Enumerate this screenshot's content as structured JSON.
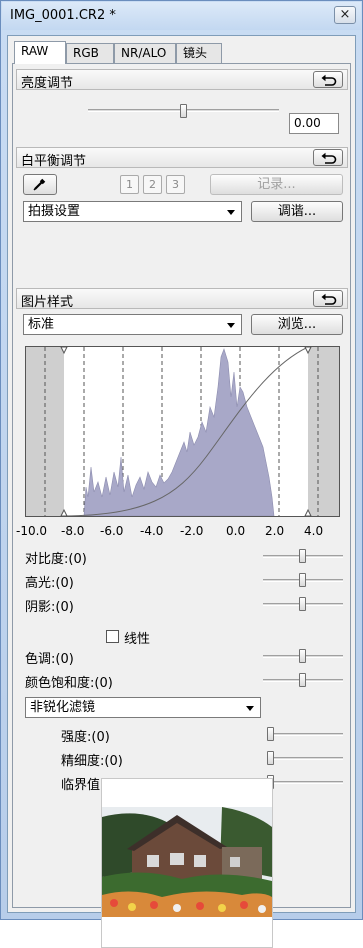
{
  "window": {
    "title": "IMG_0001.CR2 *",
    "close_glyph": "×"
  },
  "tabs": [
    {
      "label": "RAW",
      "active": true
    },
    {
      "label": "RGB",
      "active": false
    },
    {
      "label": "NR/ALO",
      "active": false
    },
    {
      "label": "镜头",
      "active": false
    }
  ],
  "brightness": {
    "title": "亮度调节",
    "value": "0.00",
    "slider_level": 0.5
  },
  "white_balance": {
    "title": "白平衡调节",
    "presets": [
      "1",
      "2",
      "3"
    ],
    "register_label": "记录...",
    "mode": "拍摄设置",
    "tune_label": "调谐..."
  },
  "picture_style": {
    "title": "图片样式",
    "style": "标准",
    "browse_label": "浏览...",
    "histogram_ticks": [
      "-10.0",
      "-8.0",
      "-6.0",
      "-4.0",
      "-2.0",
      "0.0",
      "2.0",
      "4.0"
    ],
    "params": [
      {
        "label": "对比度:(0)",
        "level": 0.5
      },
      {
        "label": "高光:(0)",
        "level": 0.5
      },
      {
        "label": "阴影:(0)",
        "level": 0.5
      },
      {
        "label": "色调:(0)",
        "level": 0.5
      },
      {
        "label": "颜色饱和度:(0)",
        "level": 0.5
      }
    ],
    "linear_label": "线性",
    "linear_checked": false,
    "sharpen_mode": "非锐化滤镜",
    "sharpen_params": [
      {
        "label": "强度:(0)",
        "level": 0
      },
      {
        "label": "精细度:(0)",
        "level": 0
      },
      {
        "label": "临界值:(0)",
        "level": 0
      }
    ]
  },
  "colors": {
    "accent": "#c3d8f1",
    "histogram_fill": "#a8a8c8",
    "clip_zone": "#cfcfcf"
  }
}
